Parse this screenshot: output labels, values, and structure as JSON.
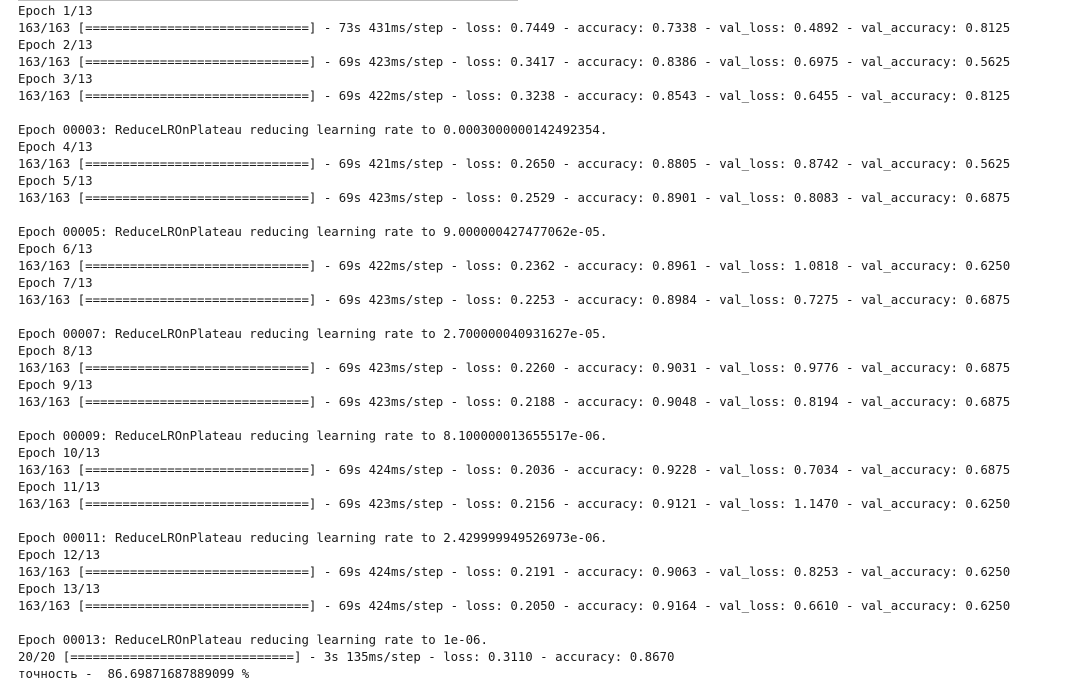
{
  "console": {
    "lines": [
      "Epoch 1/13",
      "163/163 [==============================] - 73s 431ms/step - loss: 0.7449 - accuracy: 0.7338 - val_loss: 0.4892 - val_accuracy: 0.8125",
      "Epoch 2/13",
      "163/163 [==============================] - 69s 423ms/step - loss: 0.3417 - accuracy: 0.8386 - val_loss: 0.6975 - val_accuracy: 0.5625",
      "Epoch 3/13",
      "163/163 [==============================] - 69s 422ms/step - loss: 0.3238 - accuracy: 0.8543 - val_loss: 0.6455 - val_accuracy: 0.8125",
      "",
      "Epoch 00003: ReduceLROnPlateau reducing learning rate to 0.0003000000142492354.",
      "Epoch 4/13",
      "163/163 [==============================] - 69s 421ms/step - loss: 0.2650 - accuracy: 0.8805 - val_loss: 0.8742 - val_accuracy: 0.5625",
      "Epoch 5/13",
      "163/163 [==============================] - 69s 423ms/step - loss: 0.2529 - accuracy: 0.8901 - val_loss: 0.8083 - val_accuracy: 0.6875",
      "",
      "Epoch 00005: ReduceLROnPlateau reducing learning rate to 9.000000427477062e-05.",
      "Epoch 6/13",
      "163/163 [==============================] - 69s 422ms/step - loss: 0.2362 - accuracy: 0.8961 - val_loss: 1.0818 - val_accuracy: 0.6250",
      "Epoch 7/13",
      "163/163 [==============================] - 69s 423ms/step - loss: 0.2253 - accuracy: 0.8984 - val_loss: 0.7275 - val_accuracy: 0.6875",
      "",
      "Epoch 00007: ReduceLROnPlateau reducing learning rate to 2.700000040931627e-05.",
      "Epoch 8/13",
      "163/163 [==============================] - 69s 423ms/step - loss: 0.2260 - accuracy: 0.9031 - val_loss: 0.9776 - val_accuracy: 0.6875",
      "Epoch 9/13",
      "163/163 [==============================] - 69s 423ms/step - loss: 0.2188 - accuracy: 0.9048 - val_loss: 0.8194 - val_accuracy: 0.6875",
      "",
      "Epoch 00009: ReduceLROnPlateau reducing learning rate to 8.100000013655517e-06.",
      "Epoch 10/13",
      "163/163 [==============================] - 69s 424ms/step - loss: 0.2036 - accuracy: 0.9228 - val_loss: 0.7034 - val_accuracy: 0.6875",
      "Epoch 11/13",
      "163/163 [==============================] - 69s 423ms/step - loss: 0.2156 - accuracy: 0.9121 - val_loss: 1.1470 - val_accuracy: 0.6250",
      "",
      "Epoch 00011: ReduceLROnPlateau reducing learning rate to 2.429999949526973e-06.",
      "Epoch 12/13",
      "163/163 [==============================] - 69s 424ms/step - loss: 0.2191 - accuracy: 0.9063 - val_loss: 0.8253 - val_accuracy: 0.6250",
      "Epoch 13/13",
      "163/163 [==============================] - 69s 424ms/step - loss: 0.2050 - accuracy: 0.9164 - val_loss: 0.6610 - val_accuracy: 0.6250",
      "",
      "Epoch 00013: ReduceLROnPlateau reducing learning rate to 1e-06.",
      "20/20 [==============================] - 3s 135ms/step - loss: 0.3110 - accuracy: 0.8670",
      "точность -  86.69871687889099 %"
    ]
  }
}
